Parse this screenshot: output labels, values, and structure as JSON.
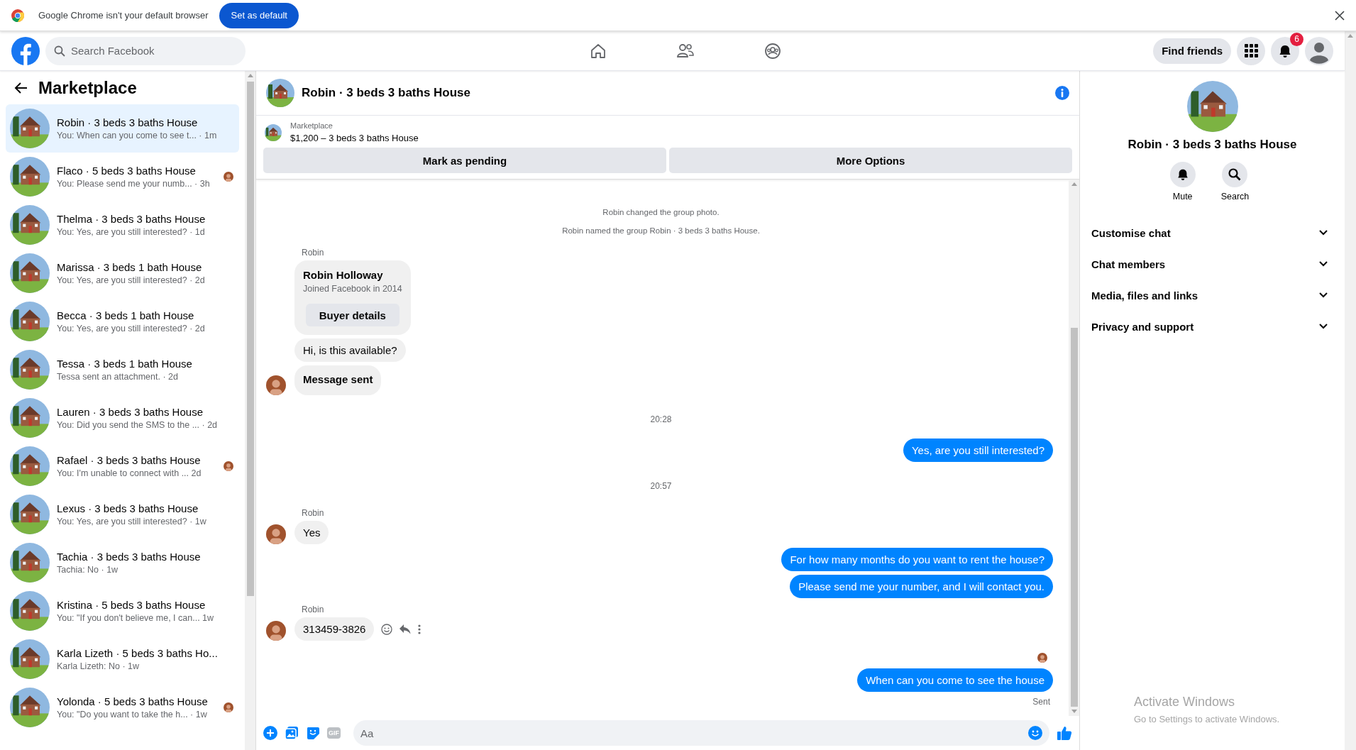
{
  "browser_bar": {
    "message": "Google Chrome isn't your default browser",
    "button": "Set as default"
  },
  "top_nav": {
    "search": {
      "placeholder": "Search Facebook"
    },
    "find_friends": "Find friends",
    "notification_count": "6"
  },
  "sidebar": {
    "title": "Marketplace",
    "conversations": [
      {
        "title": "Robin · 3 beds 3 baths House",
        "preview": "You: When can you come to see t... · 1m",
        "selected": true,
        "seen": false
      },
      {
        "title": "Flaco · 5 beds 3 baths House",
        "preview": "You: Please send me your numb... · 3h",
        "selected": false,
        "seen": true
      },
      {
        "title": "Thelma · 3 beds 3 baths House",
        "preview": "You: Yes, are you still interested? · 1d",
        "selected": false,
        "seen": false
      },
      {
        "title": "Marissa · 3 beds 1 bath House",
        "preview": "You: Yes, are you still interested? · 2d",
        "selected": false,
        "seen": false
      },
      {
        "title": "Becca · 3 beds 1 bath House",
        "preview": "You: Yes, are you still interested? · 2d",
        "selected": false,
        "seen": false
      },
      {
        "title": "Tessa · 3 beds 1 bath House",
        "preview": "Tessa sent an attachment. · 2d",
        "selected": false,
        "seen": false
      },
      {
        "title": "Lauren · 3 beds 3 baths House",
        "preview": "You: Did you send the SMS to the ... · 2d",
        "selected": false,
        "seen": false
      },
      {
        "title": "Rafael · 3 beds 3 baths House",
        "preview": "You: I'm unable to connect with ... 2d",
        "selected": false,
        "seen": true
      },
      {
        "title": "Lexus · 3 beds 3 baths House",
        "preview": "You: Yes, are you still interested? · 1w",
        "selected": false,
        "seen": false
      },
      {
        "title": "Tachia · 3 beds 3 baths House",
        "preview": "Tachia: No · 1w",
        "selected": false,
        "seen": false
      },
      {
        "title": "Kristina · 5 beds 3 baths House",
        "preview": "You: \"If you don't believe me, I can... 1w",
        "selected": false,
        "seen": false
      },
      {
        "title": "Karla Lizeth · 5 beds 3 baths Ho...",
        "preview": "Karla Lizeth: No · 1w",
        "selected": false,
        "seen": false
      },
      {
        "title": "Yolonda · 5 beds 3 baths House",
        "preview": "You: \"Do you want to take the h... · 1w",
        "selected": false,
        "seen": true
      }
    ]
  },
  "chat": {
    "title": "Robin · 3 beds 3 baths House",
    "listing": {
      "label": "Marketplace",
      "title": "$1,200 – 3 beds 3 baths House"
    },
    "actions": [
      "Mark as pending",
      "More Options"
    ],
    "messages": [
      {
        "kind": "system",
        "text": "Robin changed the group photo."
      },
      {
        "kind": "system",
        "text": "Robin named the group Robin · 3 beds 3 baths House."
      },
      {
        "kind": "sender",
        "text": "Robin"
      },
      {
        "kind": "card",
        "name": "Robin Holloway",
        "subtitle": "Joined Facebook in 2014",
        "button": "Buyer details"
      },
      {
        "kind": "incoming",
        "text": "Hi, is this available?",
        "avatar": false,
        "show_actions": false
      },
      {
        "kind": "notice",
        "text": "Message sent",
        "avatar": true
      },
      {
        "kind": "time",
        "text": "20:28"
      },
      {
        "kind": "outgoing",
        "text": "Yes, are you still interested?"
      },
      {
        "kind": "time",
        "text": "20:57"
      },
      {
        "kind": "sender",
        "text": "Robin"
      },
      {
        "kind": "incoming",
        "text": "Yes",
        "avatar": true,
        "show_actions": false
      },
      {
        "kind": "outgoing",
        "text": "For how many months do you want to rent the house?"
      },
      {
        "kind": "outgoing",
        "text": "Please send me your number, and I will contact you."
      },
      {
        "kind": "sender",
        "text": "Robin"
      },
      {
        "kind": "incoming",
        "text": "313459-3826",
        "avatar": true,
        "show_actions": true
      },
      {
        "kind": "seen"
      },
      {
        "kind": "outgoing",
        "text": "When can you come to see the house"
      },
      {
        "kind": "status",
        "text": "Sent"
      }
    ],
    "composer": {
      "gif": "GIF",
      "placeholder": "Aa"
    }
  },
  "details": {
    "title": "Robin · 3 beds 3 baths House",
    "actions": [
      {
        "kind": "mute",
        "label": "Mute"
      },
      {
        "kind": "search",
        "label": "Search"
      }
    ],
    "sections": [
      {
        "label": "Customise chat",
        "expanded": false
      },
      {
        "label": "Chat members",
        "expanded": false
      },
      {
        "label": "Media, files and links",
        "expanded": false
      },
      {
        "label": "Privacy and support",
        "expanded": false
      }
    ]
  },
  "os_notice": {
    "title": "Activate Windows",
    "text": "Go to Settings to activate Windows."
  }
}
